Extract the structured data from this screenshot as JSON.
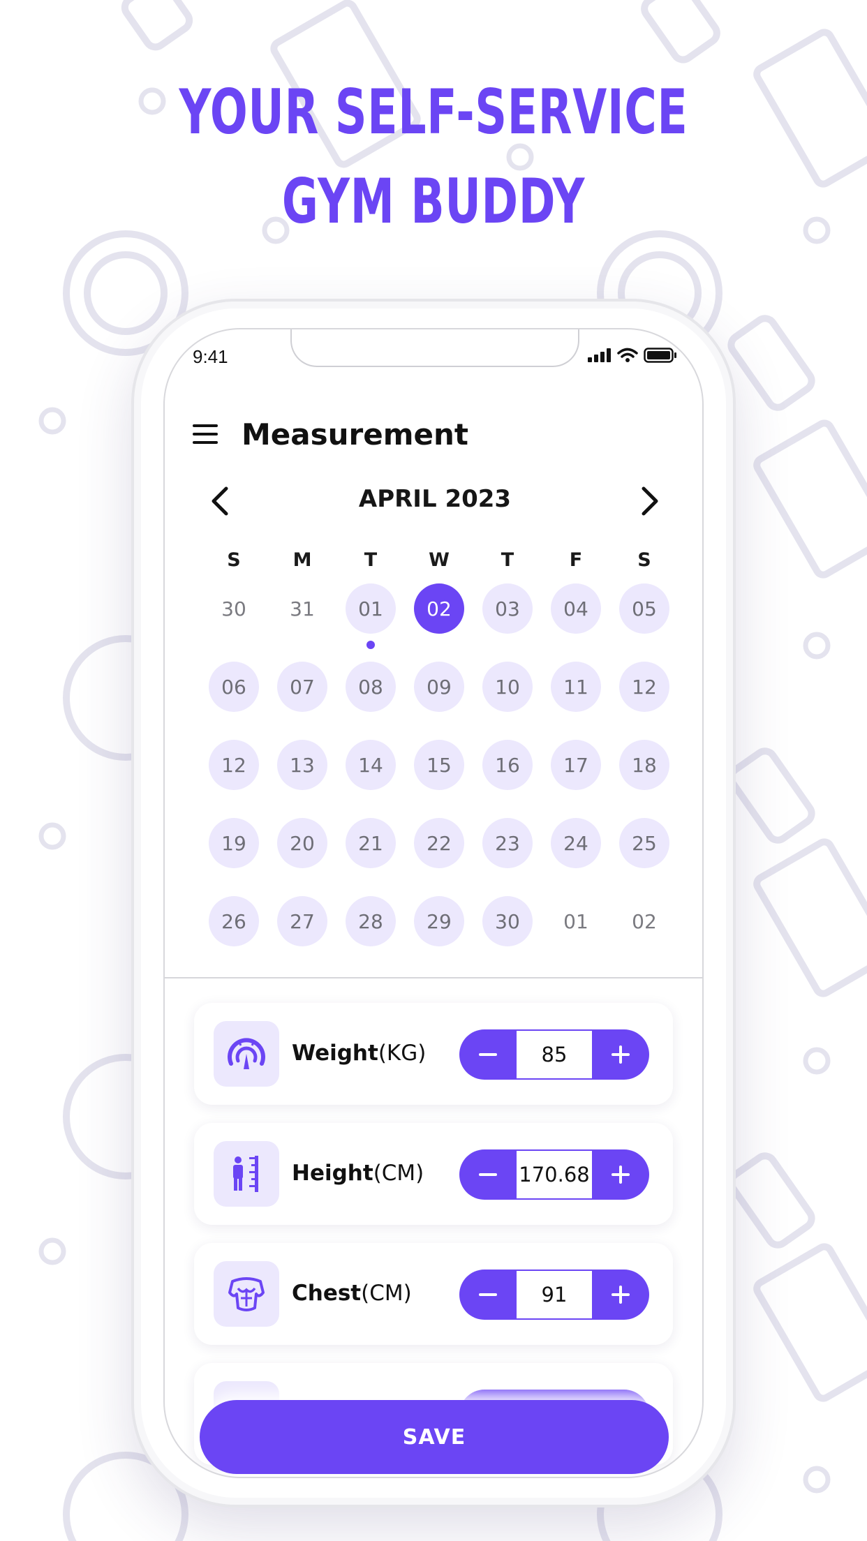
{
  "promo": {
    "headline_line1": "YOUR SELF-SERVICE",
    "headline_line2": "GYM BUDDY"
  },
  "status_bar": {
    "time": "9:41"
  },
  "header": {
    "title": "Measurement"
  },
  "calendar": {
    "month_label": "APRIL 2023",
    "weekdays": [
      "S",
      "M",
      "T",
      "W",
      "T",
      "F",
      "S"
    ],
    "weeks": [
      [
        {
          "d": "30",
          "s": "out"
        },
        {
          "d": "31",
          "s": "out"
        },
        {
          "d": "01",
          "s": "in",
          "dot": true
        },
        {
          "d": "02",
          "s": "sel"
        },
        {
          "d": "03",
          "s": "in"
        },
        {
          "d": "04",
          "s": "in"
        },
        {
          "d": "05",
          "s": "in"
        }
      ],
      [
        {
          "d": "06",
          "s": "in"
        },
        {
          "d": "07",
          "s": "in"
        },
        {
          "d": "08",
          "s": "in"
        },
        {
          "d": "09",
          "s": "in"
        },
        {
          "d": "10",
          "s": "in"
        },
        {
          "d": "11",
          "s": "in"
        },
        {
          "d": "12",
          "s": "in"
        }
      ],
      [
        {
          "d": "12",
          "s": "in"
        },
        {
          "d": "13",
          "s": "in"
        },
        {
          "d": "14",
          "s": "in"
        },
        {
          "d": "15",
          "s": "in"
        },
        {
          "d": "16",
          "s": "in"
        },
        {
          "d": "17",
          "s": "in"
        },
        {
          "d": "18",
          "s": "in"
        }
      ],
      [
        {
          "d": "19",
          "s": "in"
        },
        {
          "d": "20",
          "s": "in"
        },
        {
          "d": "21",
          "s": "in"
        },
        {
          "d": "22",
          "s": "in"
        },
        {
          "d": "23",
          "s": "in"
        },
        {
          "d": "24",
          "s": "in"
        },
        {
          "d": "25",
          "s": "in"
        }
      ],
      [
        {
          "d": "26",
          "s": "in"
        },
        {
          "d": "27",
          "s": "in"
        },
        {
          "d": "28",
          "s": "in"
        },
        {
          "d": "29",
          "s": "in"
        },
        {
          "d": "30",
          "s": "in"
        },
        {
          "d": "01",
          "s": "out"
        },
        {
          "d": "02",
          "s": "out"
        }
      ]
    ]
  },
  "measurements": {
    "weight": {
      "label": "Weight",
      "unit": "(KG)",
      "value": "85",
      "icon": "scale-gauge-icon"
    },
    "height": {
      "label": "Height",
      "unit": "(CM)",
      "value": "170.68",
      "icon": "height-ruler-icon"
    },
    "chest": {
      "label": "Chest",
      "unit": "(CM)",
      "value": "91",
      "icon": "chest-torso-icon"
    }
  },
  "actions": {
    "save_label": "SAVE"
  },
  "colors": {
    "accent": "#6b45f4",
    "accent_light": "#ece8fd",
    "pattern": "#e4e3ee"
  }
}
